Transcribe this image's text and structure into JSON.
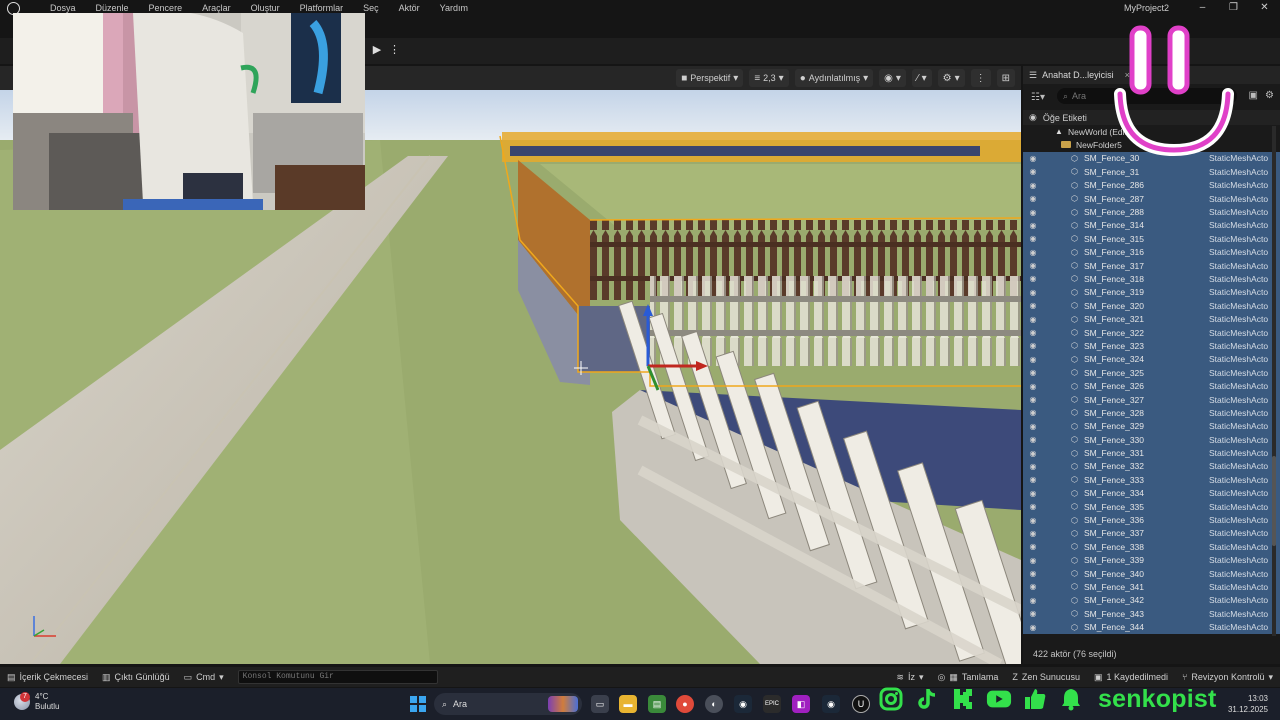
{
  "app": {
    "project_name": "MyProject2",
    "menu": [
      "Dosya",
      "Düzenle",
      "Pencere",
      "Araçlar",
      "Oluştur",
      "Platformlar",
      "Seç",
      "Aktör",
      "Yardım"
    ],
    "window_controls": [
      "–",
      "❐",
      "✕"
    ]
  },
  "viewport": {
    "perspective_label": "Perspektif",
    "camera_speed": "2,3",
    "view_mode_label": "Aydınlatılmış"
  },
  "outliner": {
    "tab_title": "Anahat D...leyicisi",
    "tab_close": "×",
    "search_placeholder": "Ara",
    "column_label": "Öğe Etiketi",
    "world_row": "NewWorld (Edito",
    "folder_row": "NewFolder5",
    "items": [
      {
        "name": "SM_Fence_30",
        "type": "StaticMeshActo"
      },
      {
        "name": "SM_Fence_31",
        "type": "StaticMeshActo"
      },
      {
        "name": "SM_Fence_286",
        "type": "StaticMeshActo"
      },
      {
        "name": "SM_Fence_287",
        "type": "StaticMeshActo"
      },
      {
        "name": "SM_Fence_288",
        "type": "StaticMeshActo"
      },
      {
        "name": "SM_Fence_314",
        "type": "StaticMeshActo"
      },
      {
        "name": "SM_Fence_315",
        "type": "StaticMeshActo"
      },
      {
        "name": "SM_Fence_316",
        "type": "StaticMeshActo"
      },
      {
        "name": "SM_Fence_317",
        "type": "StaticMeshActo"
      },
      {
        "name": "SM_Fence_318",
        "type": "StaticMeshActo"
      },
      {
        "name": "SM_Fence_319",
        "type": "StaticMeshActo"
      },
      {
        "name": "SM_Fence_320",
        "type": "StaticMeshActo"
      },
      {
        "name": "SM_Fence_321",
        "type": "StaticMeshActo"
      },
      {
        "name": "SM_Fence_322",
        "type": "StaticMeshActo"
      },
      {
        "name": "SM_Fence_323",
        "type": "StaticMeshActo"
      },
      {
        "name": "SM_Fence_324",
        "type": "StaticMeshActo"
      },
      {
        "name": "SM_Fence_325",
        "type": "StaticMeshActo"
      },
      {
        "name": "SM_Fence_326",
        "type": "StaticMeshActo"
      },
      {
        "name": "SM_Fence_327",
        "type": "StaticMeshActo"
      },
      {
        "name": "SM_Fence_328",
        "type": "StaticMeshActo"
      },
      {
        "name": "SM_Fence_329",
        "type": "StaticMeshActo"
      },
      {
        "name": "SM_Fence_330",
        "type": "StaticMeshActo"
      },
      {
        "name": "SM_Fence_331",
        "type": "StaticMeshActo"
      },
      {
        "name": "SM_Fence_332",
        "type": "StaticMeshActo"
      },
      {
        "name": "SM_Fence_333",
        "type": "StaticMeshActo"
      },
      {
        "name": "SM_Fence_334",
        "type": "StaticMeshActo"
      },
      {
        "name": "SM_Fence_335",
        "type": "StaticMeshActo"
      },
      {
        "name": "SM_Fence_336",
        "type": "StaticMeshActo"
      },
      {
        "name": "SM_Fence_337",
        "type": "StaticMeshActo"
      },
      {
        "name": "SM_Fence_338",
        "type": "StaticMeshActo"
      },
      {
        "name": "SM_Fence_339",
        "type": "StaticMeshActo"
      },
      {
        "name": "SM_Fence_340",
        "type": "StaticMeshActo"
      },
      {
        "name": "SM_Fence_341",
        "type": "StaticMeshActo"
      },
      {
        "name": "SM_Fence_342",
        "type": "StaticMeshActo"
      },
      {
        "name": "SM_Fence_343",
        "type": "StaticMeshActo"
      },
      {
        "name": "SM_Fence_344",
        "type": "StaticMeshActo"
      }
    ],
    "status": "422 aktör (76 seçildi)"
  },
  "statusbar": {
    "content_drawer": "İçerik Çekmecesi",
    "output_log": "Çıktı Günlüğü",
    "cmd": "Cmd",
    "console_placeholder": "Konsol Komutunu Gir",
    "trace": "İz",
    "derived_data": "Tanılama",
    "zen_server": "Zen Sunucusu",
    "unsaved": "1 Kaydedilmedi",
    "revision_control": "Revizyon Kontrolü"
  },
  "taskbar": {
    "temperature": "4°C",
    "weather": "Bulutlu",
    "weather_badge": "7",
    "search_label": "Ara",
    "time": "13:03",
    "date": "31.12.2025"
  },
  "overlay": {
    "brand": "senkopist"
  },
  "colors": {
    "selection": "#3a5a80",
    "brand_green": "#33e04b",
    "smiley_pink": "#e040c8"
  }
}
